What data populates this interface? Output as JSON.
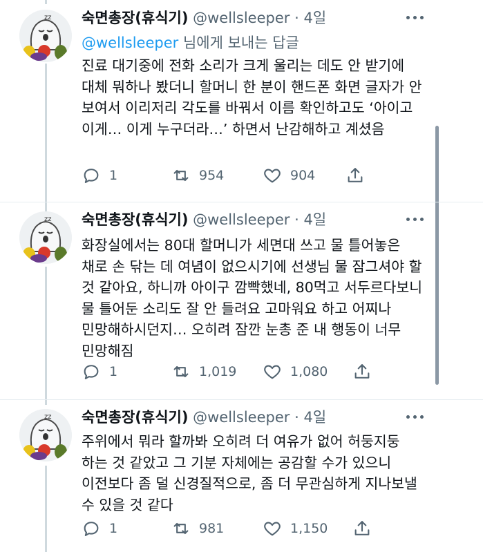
{
  "tweets": [
    {
      "name": "숙면총장(휴식기)",
      "handle": "@wellsleeper",
      "time": "4일",
      "reply_to_mention": "@wellsleeper",
      "reply_to_suffix": " 님에게 보내는 답글",
      "text": "진료 대기중에 전화 소리가 크게 울리는 데도 안 받기에 대체 뭐하나 봤더니 할머니 한 분이 핸드폰 화면 글자가 안 보여서 이리저리 각도를 바꿔서 이름 확인하고도 ‘아이고 이게… 이게 누구더라…’ 하면서 난감해하고 계셨음",
      "replies": "1",
      "retweets": "954",
      "likes": "904"
    },
    {
      "name": "숙면총장(휴식기)",
      "handle": "@wellsleeper",
      "time": "4일",
      "text": "화장실에서는 80대 할머니가 세면대 쓰고 물 틀어놓은 채로 손 닦는 데 여념이 없으시기에 선생님 물 잠그셔야 할 것 같아요, 하니까 아이구 깜빡했네, 80먹고 서두르다보니 물 틀어둔 소리도 잘 안 들려요 고마워요 하고 어찌나 민망해하시던지… 오히려 잠깐 눈총 준 내 행동이 너무 민망해짐",
      "replies": "1",
      "retweets": "1,019",
      "likes": "1,080"
    },
    {
      "name": "숙면총장(휴식기)",
      "handle": "@wellsleeper",
      "time": "4일",
      "text": "주위에서 뭐라 할까봐 오히려 더 여유가 없어 허둥지둥 하는 것 같았고 그 기분 자체에는 공감할 수가 있으니 이전보다 좀 덜 신경질적으로, 좀 더 무관심하게 지나보낼 수 있을 것 같다",
      "replies": "1",
      "retweets": "981",
      "likes": "1,150"
    }
  ],
  "separator": "·",
  "icons": {
    "reply": "reply-icon",
    "retweet": "retweet-icon",
    "like": "heart-icon",
    "share": "share-icon",
    "more": "more-icon",
    "avatar": "ghost-avatar"
  },
  "colors": {
    "accent": "#1d9bf0",
    "secondary": "#536471",
    "text": "#0f1419"
  }
}
